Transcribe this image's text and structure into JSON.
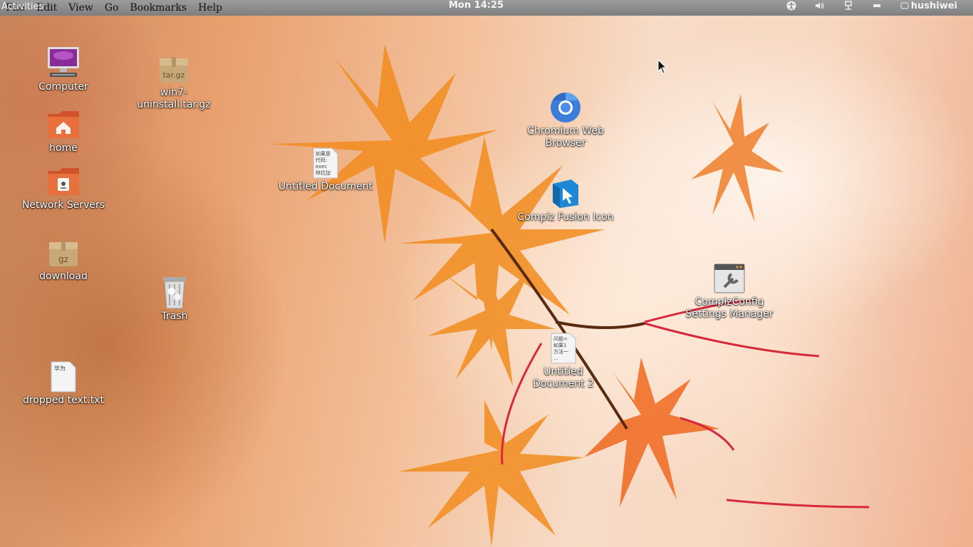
{
  "topbar": {
    "menu": [
      "File",
      "Edit",
      "View",
      "Go",
      "Bookmarks",
      "Help"
    ],
    "activities": "Activities",
    "clock": "Mon 14:25",
    "tray_icons": [
      "accessibility-icon",
      "volume-icon",
      "network-icon",
      "battery-icon"
    ],
    "user": "hushiwei"
  },
  "desktop": {
    "icons": [
      {
        "name": "Computer",
        "icon": "computer-icon"
      },
      {
        "name": "win7-uninstall.tar.gz",
        "icon": "archive-icon",
        "badge": "tar.gz"
      },
      {
        "name": "home",
        "icon": "home-folder-icon"
      },
      {
        "name": "Network Servers",
        "icon": "network-folder-icon"
      },
      {
        "name": "download",
        "icon": "archive-icon",
        "badge": "gz"
      },
      {
        "name": "Trash",
        "icon": "trash-icon"
      },
      {
        "name": "dropped text.txt",
        "icon": "text-file-icon",
        "preview": "华为"
      },
      {
        "name": "Untitled Document",
        "icon": "text-file-icon",
        "preview": "如果是\n代码:\nexec\n林拉加"
      },
      {
        "name": "Chromium Web Browser",
        "icon": "chromium-icon"
      },
      {
        "name": "Compiz Fusion Icon",
        "icon": "compiz-icon"
      },
      {
        "name": "CompizConfig Settings Manager",
        "icon": "settings-icon"
      },
      {
        "name": "Untitled Document 2",
        "icon": "text-file-icon",
        "preview": "问题<\n如果1\n方法一\n..."
      }
    ]
  },
  "colors": {
    "topbar": "#8a8a8a",
    "leaf": "#f08a24",
    "stem": "#d62a3c"
  }
}
